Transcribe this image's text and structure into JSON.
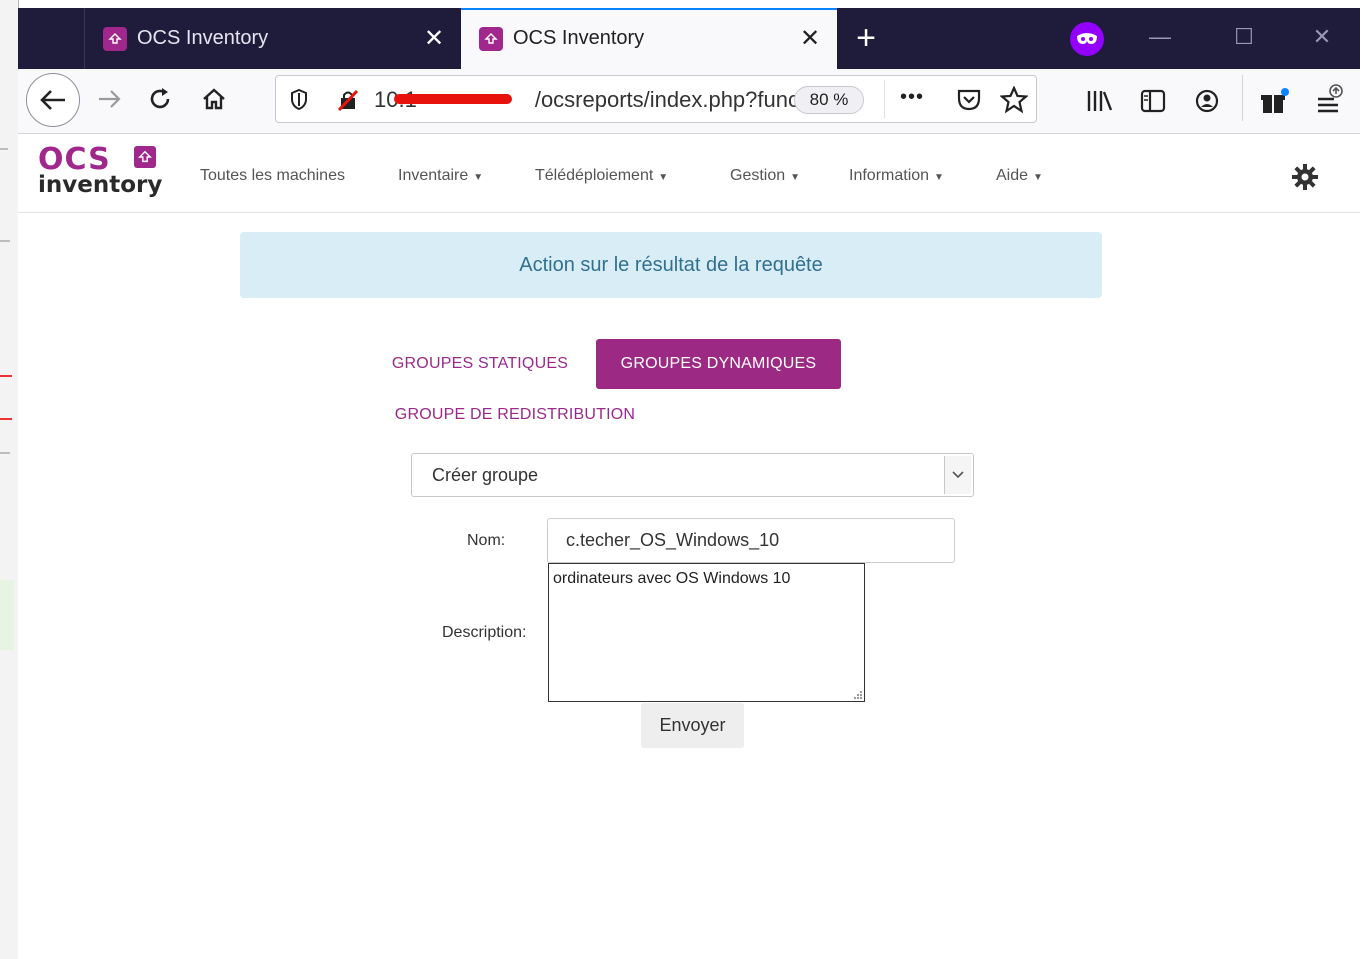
{
  "browser": {
    "tabs": [
      {
        "title": "OCS Inventory",
        "close": "✕"
      },
      {
        "title": "OCS Inventory",
        "close": "✕"
      }
    ],
    "new_tab": "+",
    "url_start": "10.1",
    "url_end": "/ocsreports/index.php?func",
    "zoom": "80 %",
    "overflow_menu": "•••",
    "window_controls": {
      "minimize": "—",
      "maximize": "☐",
      "close": "✕"
    }
  },
  "ocs": {
    "logo_top": "OCS",
    "logo_bottom": "inventory",
    "menu": [
      {
        "label": "Toutes les machines",
        "caret": false
      },
      {
        "label": "Inventaire",
        "caret": true
      },
      {
        "label": "Télédéploiement",
        "caret": true
      },
      {
        "label": "Gestion",
        "caret": true
      },
      {
        "label": "Information",
        "caret": true
      },
      {
        "label": "Aide",
        "caret": true
      }
    ],
    "alert": "Action sur le résultat de la requête",
    "tabs": {
      "static": "GROUPES STATIQUES",
      "dynamic": "GROUPES DYNAMIQUES",
      "redistribution": "GROUPE DE REDISTRIBUTION"
    },
    "select_value": "Créer groupe",
    "form": {
      "nom_label": "Nom:",
      "nom_value": "c.techer_OS_Windows_10",
      "description_label": "Description:",
      "description_value": "ordinateurs avec OS Windows 10",
      "submit": "Envoyer"
    }
  },
  "colors": {
    "brand": "#a0288c",
    "active_tab": "#9c2a85",
    "alert_bg": "#d9edf7",
    "alert_text": "#31708f",
    "titlebar": "#1f1b3b"
  }
}
